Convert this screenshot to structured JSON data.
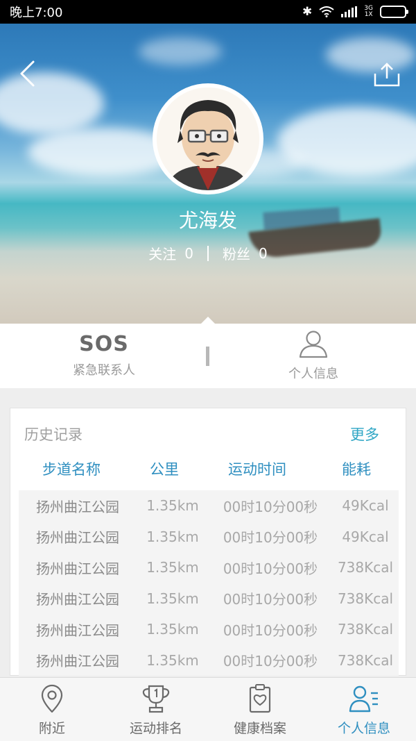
{
  "status_bar": {
    "time": "晚上7:00",
    "network": "3G\n1X"
  },
  "profile": {
    "name": "尤海发",
    "following_label": "关注",
    "following_count": "0",
    "followers_label": "粉丝",
    "followers_count": "0"
  },
  "tabs": {
    "sos_title": "SOS",
    "sos_label": "紧急联系人",
    "profile_label": "个人信息"
  },
  "history": {
    "title": "历史记录",
    "more": "更多",
    "columns": [
      "步道名称",
      "公里",
      "运动时间",
      "能耗"
    ],
    "rows": [
      [
        "扬州曲江公园",
        "1.35km",
        "00时10分00秒",
        "49Kcal"
      ],
      [
        "扬州曲江公园",
        "1.35km",
        "00时10分00秒",
        "49Kcal"
      ],
      [
        "扬州曲江公园",
        "1.35km",
        "00时10分00秒",
        "738Kcal"
      ],
      [
        "扬州曲江公园",
        "1.35km",
        "00时10分00秒",
        "738Kcal"
      ],
      [
        "扬州曲江公园",
        "1.35km",
        "00时10分00秒",
        "738Kcal"
      ],
      [
        "扬州曲江公园",
        "1.35km",
        "00时10分00秒",
        "738Kcal"
      ]
    ]
  },
  "nav": {
    "items": [
      {
        "label": "附近",
        "icon": "location-pin-icon"
      },
      {
        "label": "运动排名",
        "icon": "trophy-icon"
      },
      {
        "label": "健康档案",
        "icon": "health-record-icon"
      },
      {
        "label": "个人信息",
        "icon": "user-info-icon"
      }
    ],
    "active_index": 3
  },
  "colors": {
    "accent": "#2f8fc0",
    "more_link": "#2fa6c5",
    "muted_text": "#a8a8a8"
  }
}
